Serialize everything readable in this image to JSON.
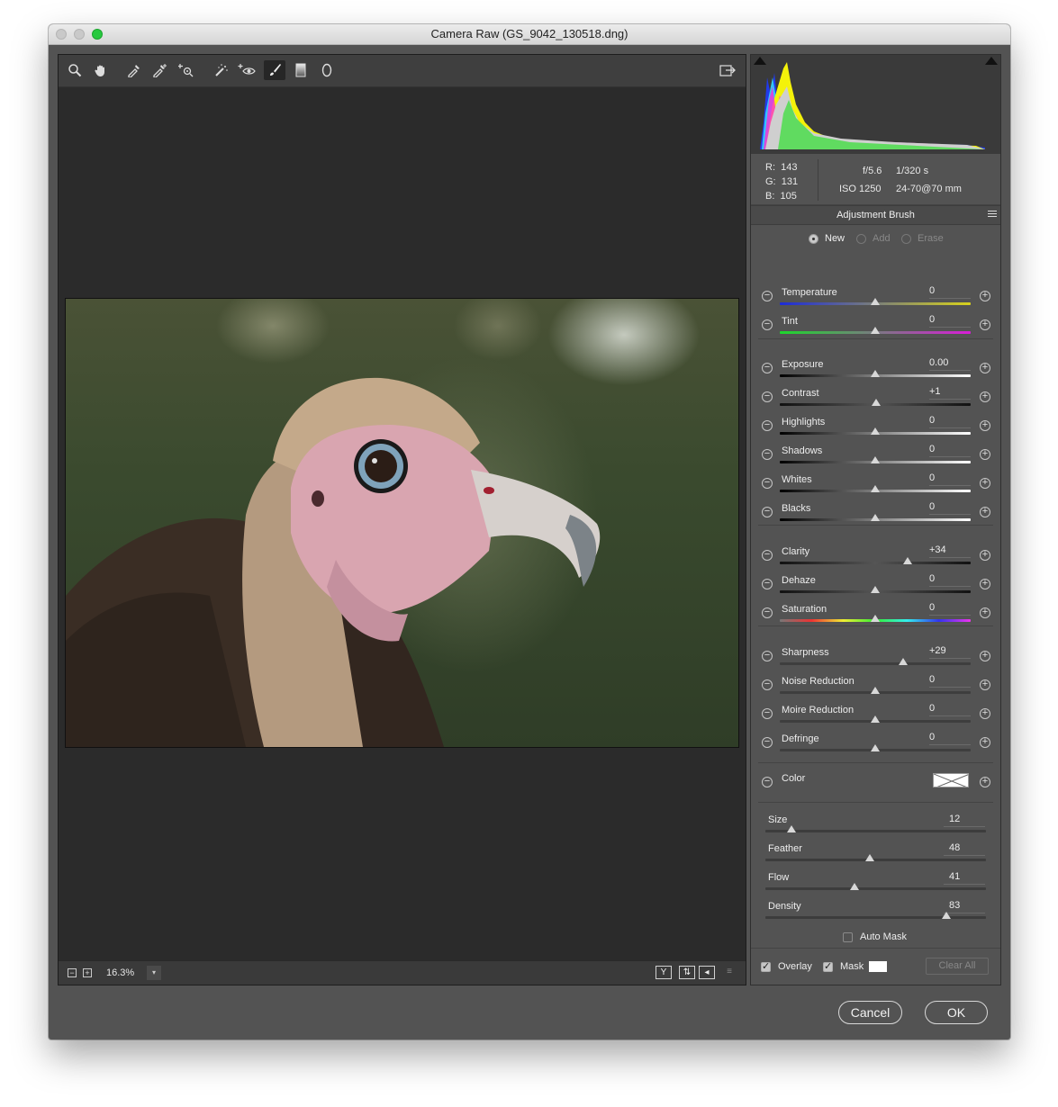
{
  "window": {
    "title": "Camera Raw (GS_9042_130518.dng)"
  },
  "toolbar": {
    "tools": [
      "zoom-icon",
      "hand-icon",
      "white-balance-icon",
      "color-sampler-icon",
      "targeted-adjustment-icon",
      "spot-removal-icon",
      "red-eye-icon",
      "adjustment-brush-icon",
      "graduated-filter-icon",
      "radial-filter-icon"
    ],
    "open_preferences": "open-in-photoshop-icon"
  },
  "bottom": {
    "zoom": "16.3%"
  },
  "info": {
    "r_label": "R:",
    "r": "143",
    "g_label": "G:",
    "g": "131",
    "b_label": "B:",
    "b": "105",
    "aperture": "f/5.6",
    "shutter": "1/320 s",
    "iso": "ISO 1250",
    "lens": "24-70@70 mm"
  },
  "panel": {
    "title": "Adjustment Brush",
    "modes": [
      "New",
      "Add",
      "Erase"
    ],
    "selected_mode": "New"
  },
  "sliders": [
    {
      "label": "Temperature",
      "value": "0",
      "pos": 0.5,
      "track": "linear-gradient(90deg,#1c2bd8,#d8d21c)"
    },
    {
      "label": "Tint",
      "value": "0",
      "pos": 0.5,
      "track": "linear-gradient(90deg,#1cd82b,#d81cd8)"
    },
    {
      "label": "Exposure",
      "value": "0.00",
      "pos": 0.5,
      "track": "linear-gradient(90deg,#000,#fff)"
    },
    {
      "label": "Contrast",
      "value": "+1",
      "pos": 0.505,
      "track": "linear-gradient(90deg,#111,#555,#111)"
    },
    {
      "label": "Highlights",
      "value": "0",
      "pos": 0.5,
      "track": "linear-gradient(90deg,#000,#fff)"
    },
    {
      "label": "Shadows",
      "value": "0",
      "pos": 0.5,
      "track": "linear-gradient(90deg,#000,#fff)"
    },
    {
      "label": "Whites",
      "value": "0",
      "pos": 0.5,
      "track": "linear-gradient(90deg,#000,#fff)"
    },
    {
      "label": "Blacks",
      "value": "0",
      "pos": 0.5,
      "track": "linear-gradient(90deg,#000,#fff)"
    },
    {
      "label": "Clarity",
      "value": "+34",
      "pos": 0.67,
      "track": "linear-gradient(90deg,#111,#555,#111)"
    },
    {
      "label": "Dehaze",
      "value": "0",
      "pos": 0.5,
      "track": "linear-gradient(90deg,#111,#555,#111)"
    },
    {
      "label": "Saturation",
      "value": "0",
      "pos": 0.5,
      "track": "linear-gradient(90deg,#777,#e33,#ee3,#3e3,#3ee,#33e,#e3e)"
    },
    {
      "label": "Sharpness",
      "value": "+29",
      "pos": 0.645,
      "track": "linear-gradient(90deg,#3e3e3e,#3e3e3e)"
    },
    {
      "label": "Noise Reduction",
      "value": "0",
      "pos": 0.5,
      "track": "linear-gradient(90deg,#3e3e3e,#3e3e3e)"
    },
    {
      "label": "Moire Reduction",
      "value": "0",
      "pos": 0.5,
      "track": "linear-gradient(90deg,#3e3e3e,#3e3e3e)"
    },
    {
      "label": "Defringe",
      "value": "0",
      "pos": 0.5,
      "track": "linear-gradient(90deg,#3e3e3e,#3e3e3e)"
    }
  ],
  "color": {
    "label": "Color"
  },
  "brush": [
    {
      "label": "Size",
      "value": "12",
      "pos": 0.12
    },
    {
      "label": "Feather",
      "value": "48",
      "pos": 0.475
    },
    {
      "label": "Flow",
      "value": "41",
      "pos": 0.405
    },
    {
      "label": "Density",
      "value": "83",
      "pos": 0.82
    }
  ],
  "auto_mask": {
    "label": "Auto Mask",
    "checked": false
  },
  "footer": {
    "overlay_label": "Overlay",
    "overlay_checked": true,
    "mask_label": "Mask",
    "mask_checked": true,
    "clear_all": "Clear All"
  },
  "buttons": {
    "cancel": "Cancel",
    "ok": "OK"
  }
}
